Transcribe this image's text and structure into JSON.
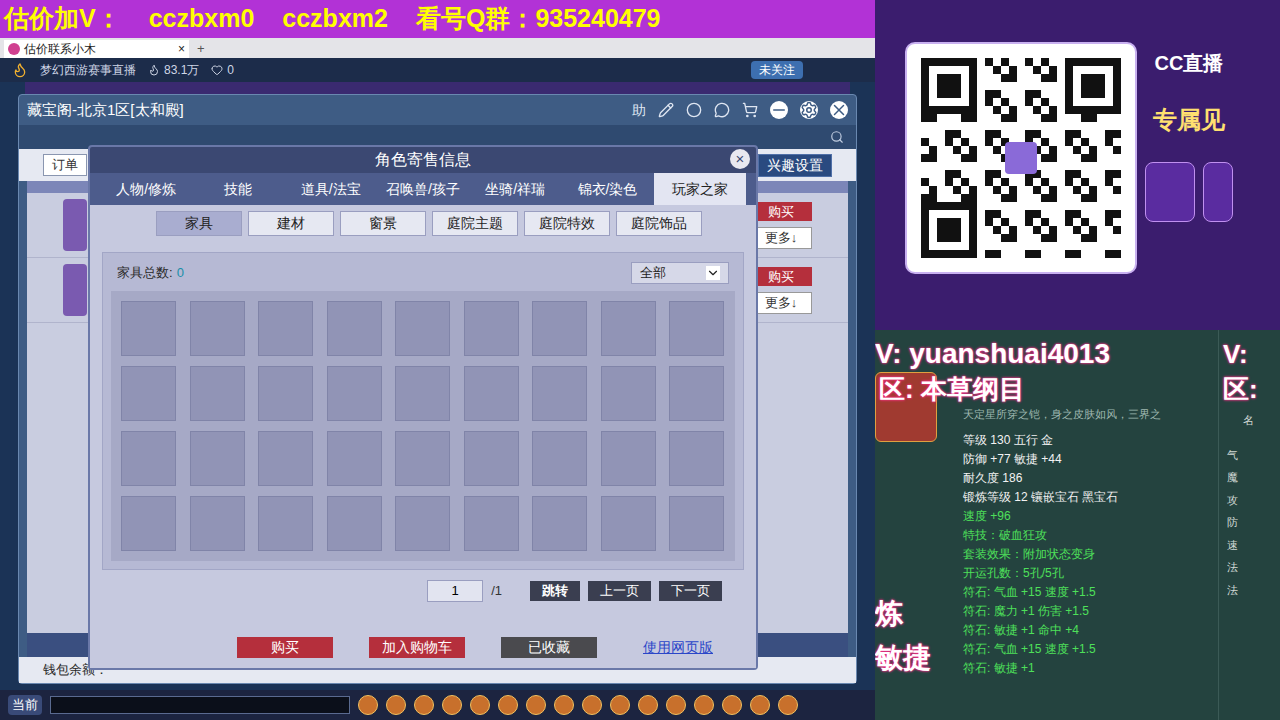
{
  "banner": {
    "items": [
      "估价加V：",
      "cczbxm0",
      "cczbxm2",
      "看号Q群：935240479"
    ]
  },
  "browser": {
    "tab": {
      "label": "估价联系小木",
      "close": "×"
    },
    "new_tab": "+"
  },
  "stream": {
    "title": "梦幻西游赛事直播",
    "popularity": "83.1万",
    "likes": "0",
    "follow": "未关注"
  },
  "cbg_window": {
    "title": "藏宝阁-北京1区[太和殿]",
    "help": "助",
    "order_button": "订单",
    "interest_button": "兴趣设置",
    "rows": [
      {
        "buy": "购买",
        "more": "更多↓"
      },
      {
        "buy": "购买",
        "more": "更多↓"
      }
    ],
    "wallet": "钱包余额："
  },
  "dialog": {
    "title": "角色寄售信息",
    "close": "×",
    "tabs": [
      {
        "label": "人物/修炼",
        "selected": false
      },
      {
        "label": "技能",
        "selected": false
      },
      {
        "label": "道具/法宝",
        "selected": false
      },
      {
        "label": "召唤兽/孩子",
        "selected": false
      },
      {
        "label": "坐骑/祥瑞",
        "selected": false
      },
      {
        "label": "锦衣/染色",
        "selected": false
      },
      {
        "label": "玩家之家",
        "selected": true
      }
    ],
    "subtabs": [
      {
        "label": "家具",
        "selected": true
      },
      {
        "label": "建材",
        "selected": false
      },
      {
        "label": "窗景",
        "selected": false
      },
      {
        "label": "庭院主题",
        "selected": false
      },
      {
        "label": "庭院特效",
        "selected": false
      },
      {
        "label": "庭院饰品",
        "selected": false
      }
    ],
    "furniture": {
      "count_label": "家具总数:",
      "count": "0",
      "filter": "全部",
      "slots": 36
    },
    "pager": {
      "page": "1",
      "total": "/1",
      "jump": "跳转",
      "prev": "上一页",
      "next": "下一页"
    },
    "buttons": [
      {
        "label": "购买",
        "kind": "primary"
      },
      {
        "label": "加入购物车",
        "kind": "primary"
      },
      {
        "label": "已收藏",
        "kind": "dark"
      },
      {
        "label": "使用网页版",
        "kind": "link"
      }
    ]
  },
  "taskbar": {
    "label": "当前"
  },
  "promo": {
    "logo": "CC直播",
    "caption": "专属见"
  },
  "overlay": {
    "contact": "V: yuanshuai4013",
    "zone": "区: 本草纲目",
    "contact2": "V:",
    "zone2": "区:",
    "bottom1": "炼",
    "bottom2": "敏捷"
  },
  "item": {
    "description": "天定星所穿之铠，身之皮肤如风，三界之",
    "stats": [
      {
        "text": "等级 130 五行 金",
        "color": "#f2f2f2"
      },
      {
        "text": "防御 +77 敏捷 +44",
        "color": "#f2f2f2"
      },
      {
        "text": "耐久度 186",
        "color": "#f2f2f2"
      },
      {
        "text": "锻炼等级 12 镶嵌宝石 黑宝石",
        "color": "#f2f2f2"
      },
      {
        "text": "速度 +96",
        "color": "#4ee05a"
      },
      {
        "text": "特技：破血狂攻",
        "color": "#4ee05a"
      },
      {
        "text": "套装效果：附加状态变身",
        "color": "#4ee05a"
      },
      {
        "text": "开运孔数：5孔/5孔",
        "color": "#4ee05a"
      },
      {
        "text": "符石: 气血 +15 速度 +1.5",
        "color": "#4ee05a"
      },
      {
        "text": "符石: 魔力 +1 伤害 +1.5",
        "color": "#4ee05a"
      },
      {
        "text": "符石: 敏捷 +1 命中 +4",
        "color": "#4ee05a"
      },
      {
        "text": "符石: 气血 +15 速度 +1.5",
        "color": "#4ee05a"
      },
      {
        "text": "符石: 敏捷 +1",
        "color": "#4ee05a"
      }
    ]
  },
  "side_labels": {
    "name": "名",
    "labels": [
      "气",
      "魔",
      "攻",
      "防",
      "速",
      "法",
      "法"
    ]
  }
}
